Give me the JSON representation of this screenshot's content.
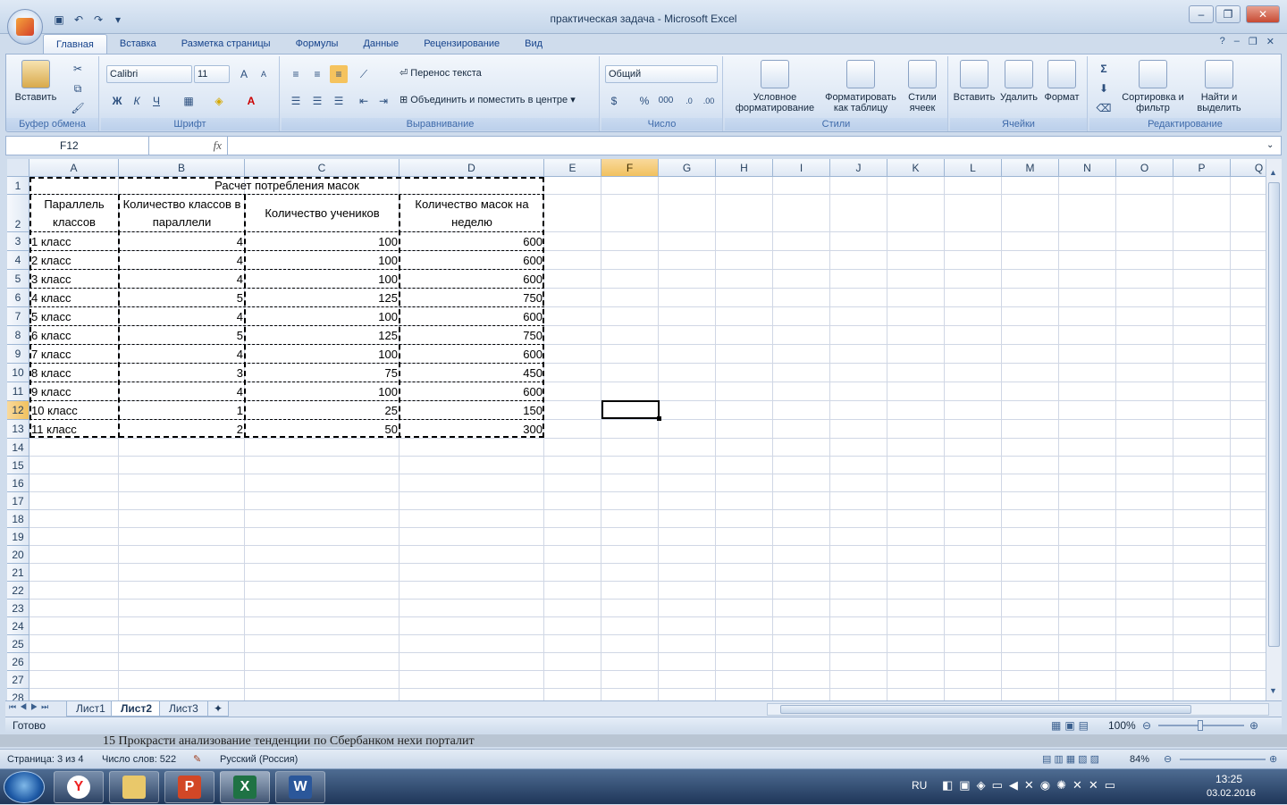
{
  "window": {
    "title": "практическая задача - Microsoft Excel"
  },
  "qat": {
    "icons": [
      "save-icon",
      "undo-icon",
      "redo-icon",
      "customize-icon"
    ]
  },
  "tabs": [
    "Главная",
    "Вставка",
    "Разметка страницы",
    "Формулы",
    "Данные",
    "Рецензирование",
    "Вид"
  ],
  "ribbon": {
    "clipboard": {
      "label": "Буфер обмена",
      "paste": "Вставить"
    },
    "font": {
      "label": "Шрифт",
      "name": "Calibri",
      "size": "11",
      "bold": "Ж",
      "italic": "К",
      "underline": "Ч",
      "grow": "A",
      "shrink": "A"
    },
    "alignment": {
      "label": "Выравнивание",
      "wrap": "Перенос текста",
      "merge": "Объединить и поместить в центре"
    },
    "number": {
      "label": "Число",
      "format": "Общий",
      "percent": "%",
      "thousands": "000"
    },
    "styles": {
      "label": "Стили",
      "conditional": "Условное форматирование",
      "as_table": "Форматировать как таблицу",
      "cell_styles": "Стили ячеек"
    },
    "cells": {
      "label": "Ячейки",
      "insert": "Вставить",
      "delete": "Удалить",
      "format": "Формат"
    },
    "editing": {
      "label": "Редактирование",
      "sort": "Сортировка и фильтр",
      "find": "Найти и выделить"
    }
  },
  "formula_bar": {
    "name_box": "F12",
    "fx": "fx",
    "value": ""
  },
  "columns": [
    "A",
    "B",
    "C",
    "D",
    "E",
    "F",
    "G",
    "H",
    "I",
    "J",
    "K",
    "L",
    "M",
    "N",
    "O",
    "P",
    "Q"
  ],
  "selected_column": "F",
  "selected_row": "12",
  "rows": [
    "1",
    "2",
    "3",
    "4",
    "5",
    "6",
    "7",
    "8",
    "9",
    "10",
    "11",
    "12",
    "13",
    "14",
    "15",
    "16",
    "17",
    "18",
    "19",
    "20",
    "21",
    "22",
    "23",
    "24",
    "25",
    "26",
    "27",
    "28"
  ],
  "sheet": {
    "title": "Расчет потребления масок",
    "headers": {
      "a1": "Параллель",
      "a2": "классов",
      "b1": "Количество классов в",
      "b2": "параллели",
      "c": "Количество учеников",
      "d1": "Количество масок на",
      "d2": "неделю"
    },
    "data": [
      {
        "a": "1 класс",
        "b": "4",
        "c": "100",
        "d": "600"
      },
      {
        "a": "2 класс",
        "b": "4",
        "c": "100",
        "d": "600"
      },
      {
        "a": "3 класс",
        "b": "4",
        "c": "100",
        "d": "600"
      },
      {
        "a": "4 класс",
        "b": "5",
        "c": "125",
        "d": "750"
      },
      {
        "a": "5 класс",
        "b": "4",
        "c": "100",
        "d": "600"
      },
      {
        "a": "6 класс",
        "b": "5",
        "c": "125",
        "d": "750"
      },
      {
        "a": "7 класс",
        "b": "4",
        "c": "100",
        "d": "600"
      },
      {
        "a": "8 класс",
        "b": "3",
        "c": "75",
        "d": "450"
      },
      {
        "a": "9 класс",
        "b": "4",
        "c": "100",
        "d": "600"
      },
      {
        "a": "10 класс",
        "b": "1",
        "c": "25",
        "d": "150"
      },
      {
        "a": "11 класс",
        "b": "2",
        "c": "50",
        "d": "300"
      }
    ]
  },
  "sheet_tabs": [
    "Лист1",
    "Лист2",
    "Лист3"
  ],
  "active_sheet": "Лист2",
  "status": {
    "ready": "Готово",
    "zoom": "100%"
  },
  "word": {
    "background_text": "15 Прокрасти   анализование   тенденции   по   Сбербанком   нехи   порталит",
    "page": "Страница: 3 из 4",
    "words": "Число слов: 522",
    "language": "Русский (Россия)",
    "zoom": "84%"
  },
  "taskbar": {
    "lang": "RU",
    "time": "13:25",
    "date": "03.02.2016",
    "apps": [
      "yandex-browser",
      "file-explorer",
      "powerpoint",
      "excel",
      "word"
    ]
  }
}
